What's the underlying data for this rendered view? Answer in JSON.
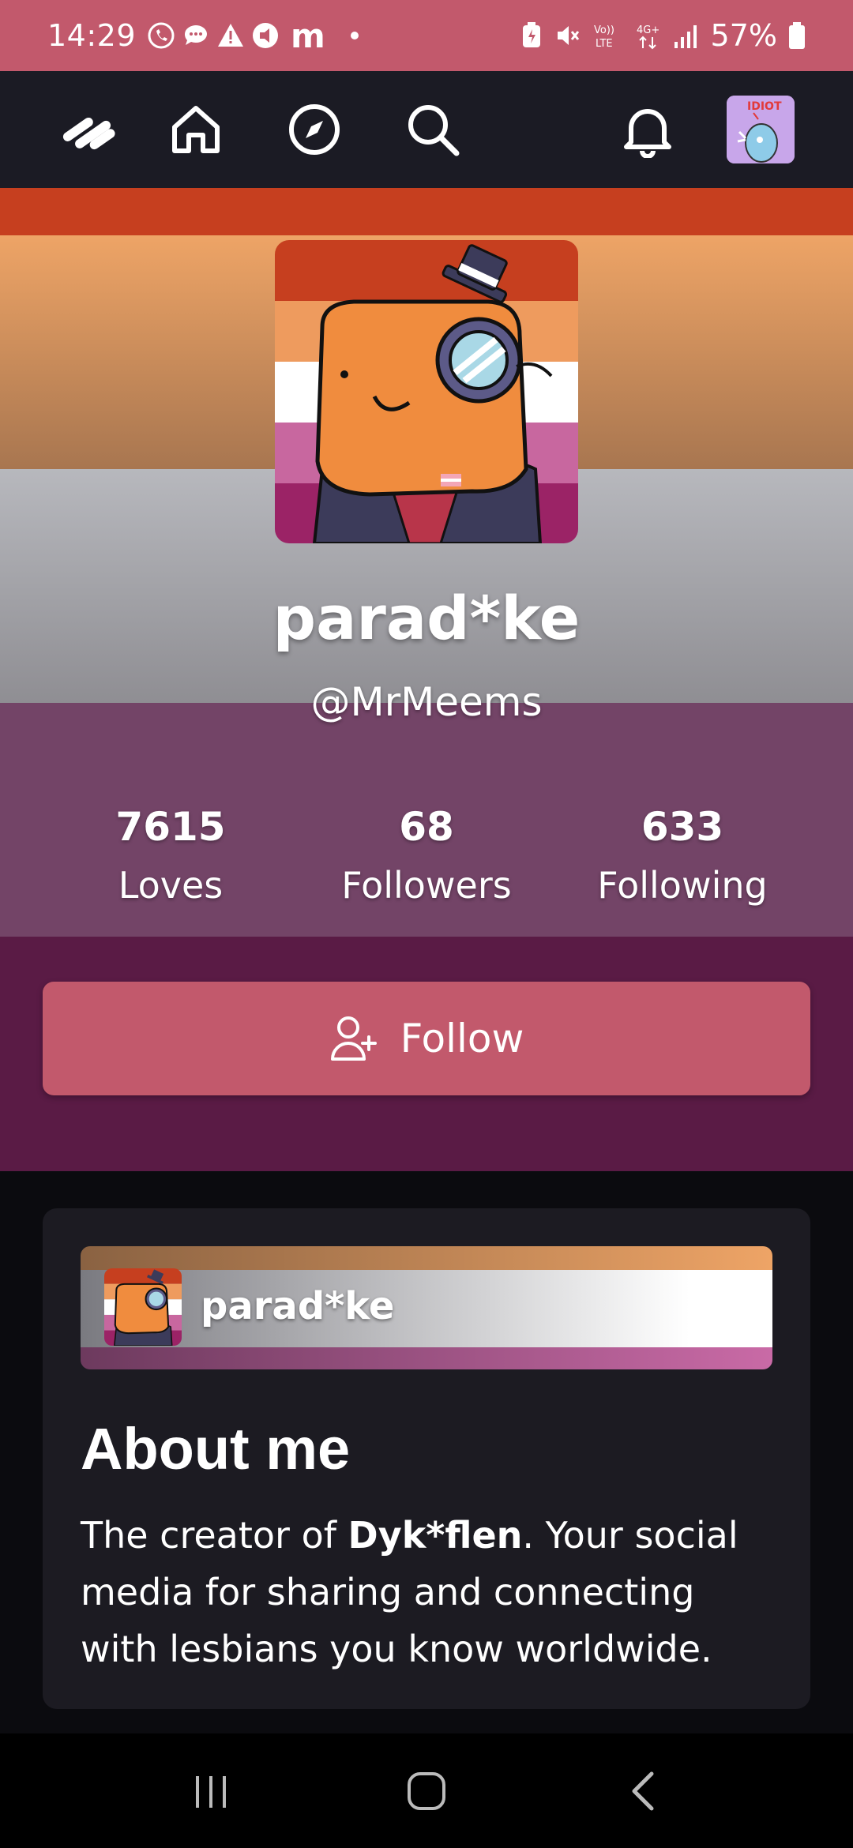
{
  "status_bar": {
    "time": "14:29",
    "carrier_glyph": "m",
    "battery_pct": "57%",
    "icons": [
      "viber-icon",
      "chat-bubble-icon",
      "warning-icon",
      "cast-icon",
      "battery-saver-icon",
      "mute-icon",
      "volte-icon",
      "4g-icon",
      "signal-icon",
      "battery-icon"
    ]
  },
  "header": {
    "icons": [
      "app-logo-icon",
      "home-icon",
      "compass-icon",
      "search-icon",
      "bell-icon"
    ],
    "avatar_text": "IDIOT"
  },
  "profile": {
    "name": "parad*ke",
    "handle": "@MrMeems",
    "stats": [
      {
        "value": "7615",
        "label": "Loves"
      },
      {
        "value": "68",
        "label": "Followers"
      },
      {
        "value": "633",
        "label": "Following"
      }
    ],
    "follow_label": "Follow"
  },
  "about": {
    "banner_name": "parad*ke",
    "heading": "About me",
    "text_prefix": "The creator of ",
    "text_bold": "Dyk*flen",
    "text_suffix": ". Your social media for sharing and connecting with lesbians you know worldwide."
  },
  "colors": {
    "accent": "#c2596c",
    "header_bg": "#1b1b24",
    "card_bg": "#1c1b22",
    "flag": [
      "#c63f1f",
      "#eea466",
      "#b7b8bd",
      "#734467",
      "#5a1b45"
    ]
  }
}
